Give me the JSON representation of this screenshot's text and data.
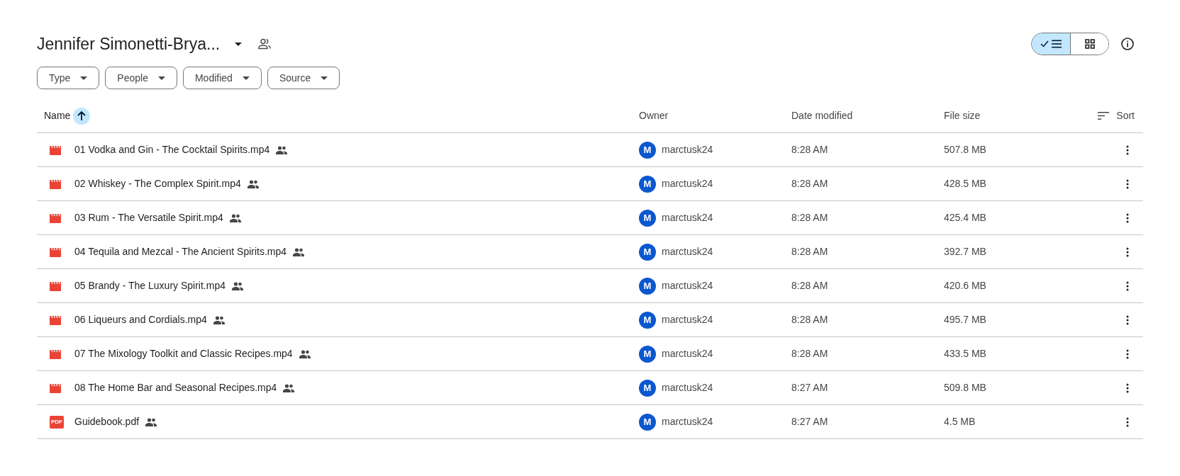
{
  "header": {
    "title": "Jennifer Simonetti-Brya...",
    "view_toggle": [
      {
        "kind": "list",
        "selected": true
      },
      {
        "kind": "grid",
        "selected": false
      }
    ]
  },
  "filters": [
    "Type",
    "People",
    "Modified",
    "Source"
  ],
  "table": {
    "columns": [
      {
        "label": "Name",
        "sorted_ascending": true
      },
      {
        "label": "Owner"
      },
      {
        "label": "Date modified"
      },
      {
        "label": "File size"
      }
    ],
    "sort_label": "Sort",
    "rows": [
      {
        "kind": "video",
        "name": "01 Vodka and Gin - The Cocktail Spirits.mp4",
        "shared": true,
        "owner_initial": "M",
        "owner": "marctusk24",
        "modified": "8:28 AM",
        "size": "507.8 MB"
      },
      {
        "kind": "video",
        "name": "02 Whiskey - The Complex Spirit.mp4",
        "shared": true,
        "owner_initial": "M",
        "owner": "marctusk24",
        "modified": "8:28 AM",
        "size": "428.5 MB"
      },
      {
        "kind": "video",
        "name": "03 Rum - The Versatile Spirit.mp4",
        "shared": true,
        "owner_initial": "M",
        "owner": "marctusk24",
        "modified": "8:28 AM",
        "size": "425.4 MB"
      },
      {
        "kind": "video",
        "name": "04 Tequila and Mezcal - The Ancient Spirits.mp4",
        "shared": true,
        "owner_initial": "M",
        "owner": "marctusk24",
        "modified": "8:28 AM",
        "size": "392.7 MB"
      },
      {
        "kind": "video",
        "name": "05 Brandy - The Luxury Spirit.mp4",
        "shared": true,
        "owner_initial": "M",
        "owner": "marctusk24",
        "modified": "8:28 AM",
        "size": "420.6 MB"
      },
      {
        "kind": "video",
        "name": "06 Liqueurs and Cordials.mp4",
        "shared": true,
        "owner_initial": "M",
        "owner": "marctusk24",
        "modified": "8:28 AM",
        "size": "495.7 MB"
      },
      {
        "kind": "video",
        "name": "07 The Mixology Toolkit and Classic Recipes.mp4",
        "shared": true,
        "owner_initial": "M",
        "owner": "marctusk24",
        "modified": "8:28 AM",
        "size": "433.5 MB"
      },
      {
        "kind": "video",
        "name": "08 The Home Bar and Seasonal Recipes.mp4",
        "shared": true,
        "owner_initial": "M",
        "owner": "marctusk24",
        "modified": "8:27 AM",
        "size": "509.8 MB"
      },
      {
        "kind": "pdf",
        "icon_text": "PDF",
        "name": "Guidebook.pdf",
        "shared": true,
        "owner_initial": "M",
        "owner": "marctusk24",
        "modified": "8:27 AM",
        "size": "4.5 MB"
      }
    ]
  }
}
